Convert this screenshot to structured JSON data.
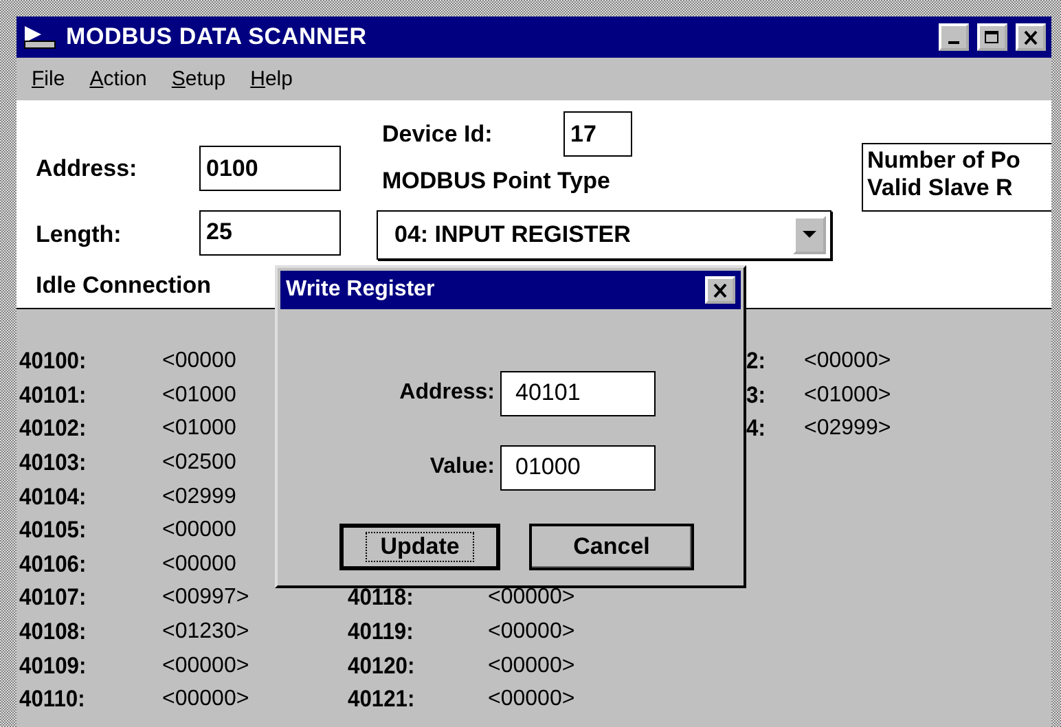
{
  "window": {
    "title": "MODBUS DATA SCANNER"
  },
  "menu": [
    {
      "label": "File"
    },
    {
      "label": "Action"
    },
    {
      "label": "Setup"
    },
    {
      "label": "Help"
    }
  ],
  "form": {
    "address": {
      "label": "Address:",
      "value": "0100"
    },
    "device_id": {
      "label": "Device Id:",
      "value": "17"
    },
    "point_type": {
      "label": "MODBUS Point Type",
      "value": "04: INPUT REGISTER"
    },
    "length": {
      "label": "Length:",
      "value": "25"
    },
    "info": [
      "Number of Po",
      "Valid Slave R"
    ],
    "status": "Idle Connection"
  },
  "registers": [
    {
      "column_1": {
        "label": "40100:",
        "value": "<00000"
      },
      "column_3": {
        "label": "2:",
        "value": "<00000>"
      }
    },
    {
      "column_1": {
        "label": "40101:",
        "value": "<01000"
      },
      "column_3": {
        "label": "3:",
        "value": "<01000>"
      }
    },
    {
      "column_1": {
        "label": "40102:",
        "value": "<01000"
      },
      "column_3": {
        "label": "4:",
        "value": "<02999>"
      }
    },
    {
      "column_1": {
        "label": "40103:",
        "value": "<02500"
      }
    },
    {
      "column_1": {
        "label": "40104:",
        "value": "<02999"
      }
    },
    {
      "column_1": {
        "label": "40105:",
        "value": "<00000"
      }
    },
    {
      "column_1": {
        "label": "40106:",
        "value": "<00000"
      }
    },
    {
      "column_1": {
        "label": "40107:",
        "value": "<00997>"
      },
      "column_2": {
        "label": "40118:",
        "value": "<00000>"
      }
    },
    {
      "column_1": {
        "label": "40108:",
        "value": "<01230>"
      },
      "column_2": {
        "label": "40119:",
        "value": "<00000>"
      }
    },
    {
      "column_1": {
        "label": "40109:",
        "value": "<00000>"
      },
      "column_2": {
        "label": "40120:",
        "value": "<00000>"
      }
    },
    {
      "column_1": {
        "label": "40110:",
        "value": "<00000>"
      },
      "column_2": {
        "label": "40121:",
        "value": "<00000>"
      }
    }
  ],
  "dialog": {
    "title": "Write Register",
    "fields": [
      {
        "label": "Address:",
        "value": "40101"
      },
      {
        "label": "Value:",
        "value": "01000"
      }
    ],
    "buttons": [
      {
        "label": "Update",
        "default": true
      },
      {
        "label": "Cancel",
        "default": false
      }
    ]
  }
}
